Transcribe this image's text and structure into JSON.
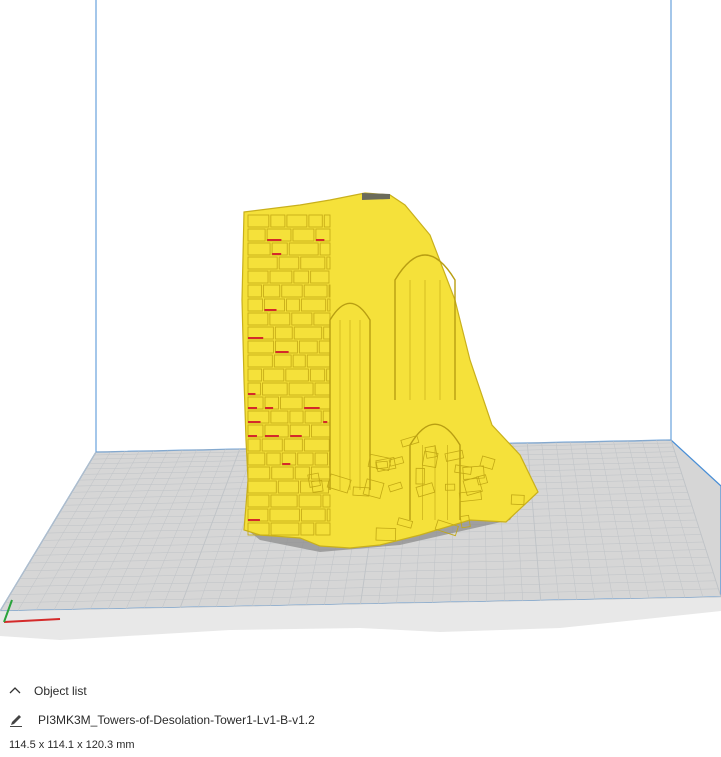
{
  "viewport": {
    "background": "#ffffff",
    "build_volume_edge_color": "#4a8fd6",
    "build_plate_color": "#d8d8d8",
    "grid_line_color": "#bfc3c7",
    "model_color": "#f5e13a",
    "model_highlight_color": "#d42a2a",
    "axis_x_color": "#d42a2a",
    "axis_y_color": "#2aa33c"
  },
  "object_list": {
    "header_label": "Object list",
    "toggle_icon": "chevron-up-icon",
    "edit_icon": "pencil-icon",
    "object_name": "PI3MK3M_Towers-of-Desolation-Tower1-Lv1-B-v1.2",
    "dimensions": "114.5 x 114.1 x 120.3 mm"
  }
}
